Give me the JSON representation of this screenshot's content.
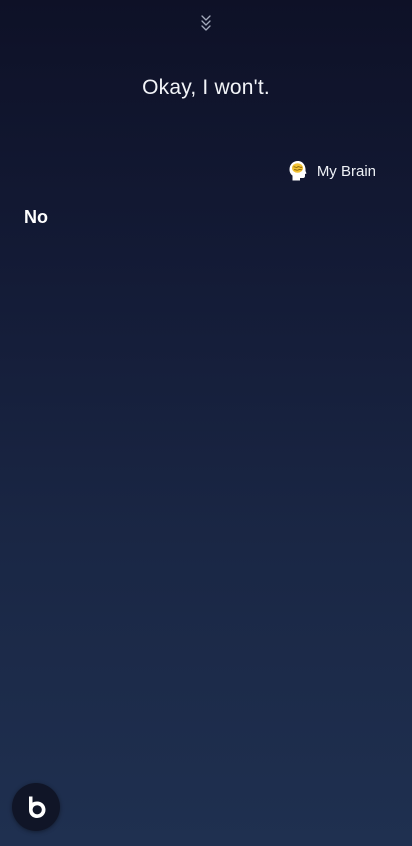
{
  "header": {
    "collapse_icon": "double-chevron-down-icon"
  },
  "response": {
    "text": "Okay, I won't."
  },
  "capsule": {
    "label": "My Brain",
    "icon": "brain-head-icon"
  },
  "utterance": {
    "text": "No"
  },
  "bixby": {
    "icon": "bixby-logo-icon"
  },
  "colors": {
    "background_top": "#0e1127",
    "background_bottom": "#1f3050",
    "text": "#ffffff",
    "brain_accent": "#f2c233"
  }
}
